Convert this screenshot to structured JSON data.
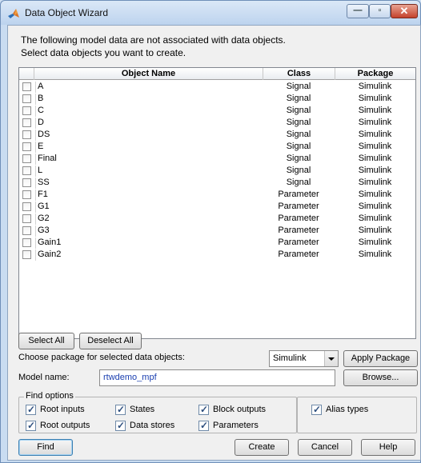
{
  "window": {
    "title": "Data Object Wizard"
  },
  "intro": {
    "line1": "The following model data are not associated with data objects.",
    "line2": "Select data objects you want to create."
  },
  "table": {
    "headers": {
      "name": "Object Name",
      "class": "Class",
      "package": "Package"
    },
    "rows": [
      {
        "name": "A",
        "class": "Signal",
        "package": "Simulink",
        "checked": false
      },
      {
        "name": "B",
        "class": "Signal",
        "package": "Simulink",
        "checked": false
      },
      {
        "name": "C",
        "class": "Signal",
        "package": "Simulink",
        "checked": false
      },
      {
        "name": "D",
        "class": "Signal",
        "package": "Simulink",
        "checked": false
      },
      {
        "name": "DS",
        "class": "Signal",
        "package": "Simulink",
        "checked": false
      },
      {
        "name": "E",
        "class": "Signal",
        "package": "Simulink",
        "checked": false
      },
      {
        "name": "Final",
        "class": "Signal",
        "package": "Simulink",
        "checked": false
      },
      {
        "name": "L",
        "class": "Signal",
        "package": "Simulink",
        "checked": false
      },
      {
        "name": "SS",
        "class": "Signal",
        "package": "Simulink",
        "checked": false
      },
      {
        "name": "F1",
        "class": "Parameter",
        "package": "Simulink",
        "checked": false
      },
      {
        "name": "G1",
        "class": "Parameter",
        "package": "Simulink",
        "checked": false
      },
      {
        "name": "G2",
        "class": "Parameter",
        "package": "Simulink",
        "checked": false
      },
      {
        "name": "G3",
        "class": "Parameter",
        "package": "Simulink",
        "checked": false
      },
      {
        "name": "Gain1",
        "class": "Parameter",
        "package": "Simulink",
        "checked": false
      },
      {
        "name": "Gain2",
        "class": "Parameter",
        "package": "Simulink",
        "checked": false
      }
    ]
  },
  "buttons": {
    "select_all": "Select All",
    "deselect_all": "Deselect All",
    "apply_package": "Apply Package",
    "browse": "Browse...",
    "find": "Find",
    "create": "Create",
    "cancel": "Cancel",
    "help": "Help"
  },
  "package": {
    "label": "Choose package for selected data objects:",
    "selected": "Simulink"
  },
  "model": {
    "label": "Model name:",
    "value": "rtwdemo_mpf"
  },
  "find_options": {
    "legend": "Find options",
    "root_inputs": {
      "label": "Root inputs",
      "checked": true
    },
    "root_outputs": {
      "label": "Root outputs",
      "checked": true
    },
    "states": {
      "label": "States",
      "checked": true
    },
    "data_stores": {
      "label": "Data stores",
      "checked": true
    },
    "block_outputs": {
      "label": "Block outputs",
      "checked": true
    },
    "parameters": {
      "label": "Parameters",
      "checked": true
    },
    "alias_types": {
      "label": "Alias types",
      "checked": true
    }
  },
  "icons": {
    "app": "matlab-icon",
    "minimize": "minimize-icon",
    "maximize": "maximize-icon",
    "close": "close-icon"
  }
}
